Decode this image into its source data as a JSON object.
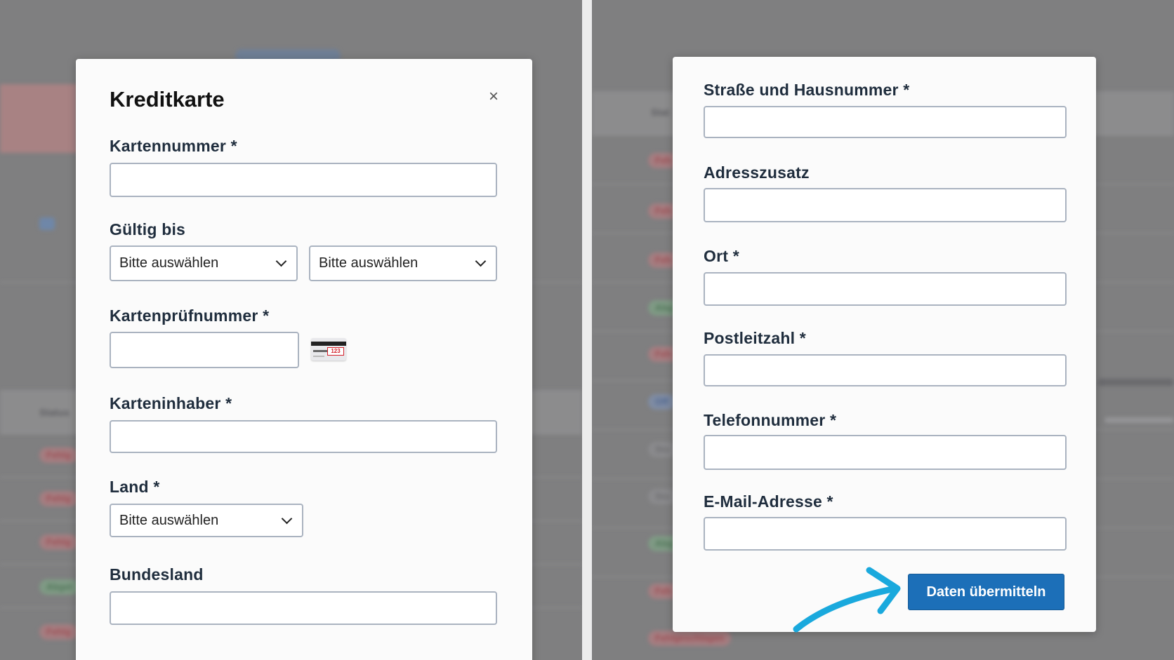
{
  "left_modal": {
    "title": "Kreditkarte",
    "close_label": "×",
    "card_number": {
      "label": "Kartennummer *",
      "value": ""
    },
    "valid_until": {
      "label": "Gültig bis",
      "month_select": "Bitte auswählen",
      "year_select": "Bitte auswählen"
    },
    "cvv": {
      "label": "Kartenprüfnummer *",
      "value": "",
      "card_hint_number": "123"
    },
    "card_holder": {
      "label": "Karteninhaber *",
      "value": ""
    },
    "country": {
      "label": "Land *",
      "select": "Bitte auswählen"
    },
    "state": {
      "label": "Bundesland",
      "value": ""
    }
  },
  "right_modal": {
    "street": {
      "label": "Straße und Hausnummer *",
      "value": ""
    },
    "address_extra": {
      "label": "Adresszusatz",
      "value": ""
    },
    "city": {
      "label": "Ort *",
      "value": ""
    },
    "postal_code": {
      "label": "Postleitzahl *",
      "value": ""
    },
    "phone": {
      "label": "Telefonnummer *",
      "value": ""
    },
    "email": {
      "label": "E-Mail-Adresse *",
      "value": ""
    },
    "submit_label": "Daten übermitteln"
  },
  "background_left": {
    "status_header": "Status",
    "status_pills": [
      "Fehlg",
      "Fehlg",
      "Fehlg",
      "Abget",
      "Fehlg"
    ]
  },
  "background_right": {
    "status_header": "Stat",
    "status_pills": [
      "Feh",
      "Feh",
      "Feh",
      "Abg",
      "Feh",
      "Off",
      "Sto",
      "Sto",
      "Abg",
      "Feh"
    ],
    "bottom_pill": "Fehlgeschlagen"
  },
  "colors": {
    "submit_button": "#1c6fb8",
    "arrow": "#1aa9dd",
    "input_border": "#aab3c0"
  }
}
